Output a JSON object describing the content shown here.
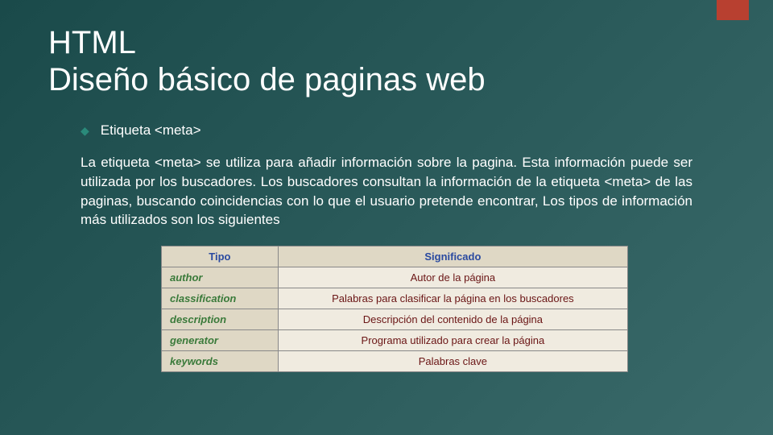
{
  "title_line1": "HTML",
  "title_line2": "Diseño básico de paginas web",
  "bullet": "Etiqueta <meta>",
  "paragraph": "La etiqueta <meta> se utiliza para añadir información sobre la pagina. Esta información puede ser utilizada por los buscadores. Los buscadores consultan la información de la etiqueta <meta> de las paginas, buscando coincidencias con lo que el usuario pretende encontrar, Los tipos de información más utilizados son los siguientes",
  "table": {
    "headers": [
      "Tipo",
      "Significado"
    ],
    "rows": [
      {
        "type": "author",
        "meaning": "Autor de la página"
      },
      {
        "type": "classification",
        "meaning": "Palabras para clasificar la página en los buscadores"
      },
      {
        "type": "description",
        "meaning": "Descripción del contenido de la página"
      },
      {
        "type": "generator",
        "meaning": "Programa utilizado para crear la página"
      },
      {
        "type": "keywords",
        "meaning": "Palabras clave"
      }
    ]
  }
}
